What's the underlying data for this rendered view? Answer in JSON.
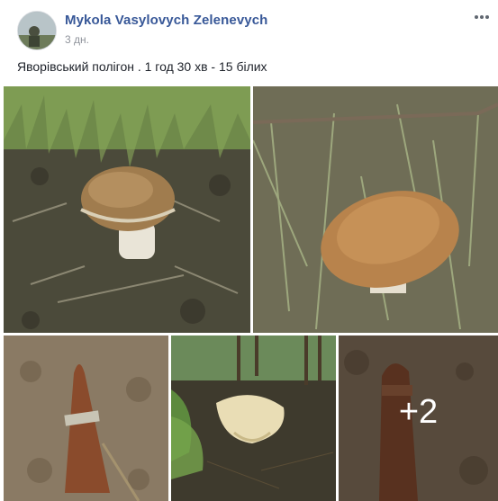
{
  "post": {
    "author": "Mykola Vasylovych Zelenevych",
    "time": "3 дн.",
    "text": "Яворівський полігон . 1 год 30 хв - 15 білих"
  },
  "gallery": {
    "photos": [
      {
        "name": "photo-mushroom-1"
      },
      {
        "name": "photo-mushroom-2"
      },
      {
        "name": "photo-shell-1"
      },
      {
        "name": "photo-mushroom-3"
      },
      {
        "name": "photo-shell-2"
      }
    ],
    "more_count": "+2"
  },
  "icons": {
    "menu": "more-options-icon"
  }
}
